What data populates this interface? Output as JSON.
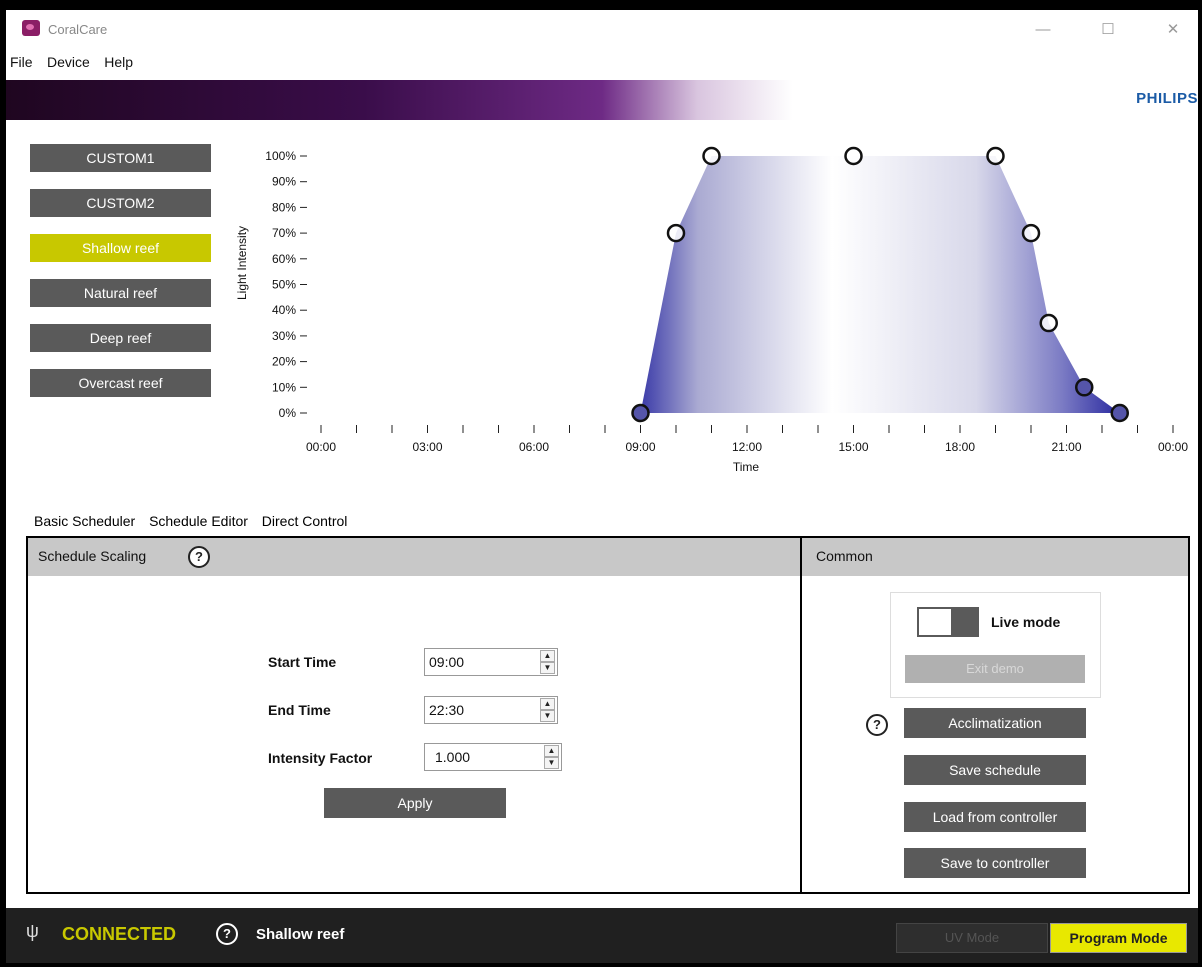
{
  "window": {
    "title": "CoralCare",
    "minimize": "—",
    "maximize": "☐",
    "close": "✕"
  },
  "menu": [
    "File",
    "Device",
    "Help"
  ],
  "brand": "PHILIPS",
  "presets": [
    {
      "label": "CUSTOM1",
      "active": false
    },
    {
      "label": "CUSTOM2",
      "active": false
    },
    {
      "label": "Shallow reef",
      "active": true
    },
    {
      "label": "Natural reef",
      "active": false
    },
    {
      "label": "Deep reef",
      "active": false
    },
    {
      "label": "Overcast reef",
      "active": false
    }
  ],
  "chart_data": {
    "type": "area",
    "xlabel": "Time",
    "ylabel": "Light Intensity",
    "x_ticks": [
      "00:00",
      "03:00",
      "06:00",
      "09:00",
      "12:00",
      "15:00",
      "18:00",
      "21:00",
      "00:00"
    ],
    "y_ticks": [
      "0%",
      "10%",
      "20%",
      "30%",
      "40%",
      "50%",
      "60%",
      "70%",
      "80%",
      "90%",
      "100%"
    ],
    "ylim": [
      0,
      100
    ],
    "xlim_hours": [
      0,
      24
    ],
    "points": [
      {
        "x": "09:00",
        "y": 0,
        "style": "filled"
      },
      {
        "x": "10:00",
        "y": 70,
        "style": "hollow"
      },
      {
        "x": "11:00",
        "y": 100,
        "style": "hollow"
      },
      {
        "x": "15:00",
        "y": 100,
        "style": "hollow"
      },
      {
        "x": "19:00",
        "y": 100,
        "style": "hollow"
      },
      {
        "x": "20:00",
        "y": 70,
        "style": "hollow"
      },
      {
        "x": "20:30",
        "y": 35,
        "style": "hollow"
      },
      {
        "x": "21:30",
        "y": 10,
        "style": "filled"
      },
      {
        "x": "22:30",
        "y": 0,
        "style": "filled"
      }
    ],
    "colors": {
      "fill_edge": "#3a3aa8",
      "fill_mid": "#ffffff",
      "filled_marker": "#5555aa",
      "hollow_marker": "#aaaaaa"
    }
  },
  "tabs": [
    {
      "label": "Basic Scheduler",
      "active": true
    },
    {
      "label": "Schedule Editor",
      "active": false
    },
    {
      "label": "Direct Control",
      "active": false
    }
  ],
  "scaling": {
    "title": "Schedule Scaling",
    "help": "?",
    "start_label": "Start Time",
    "start_value": "09:00",
    "end_label": "End Time",
    "end_value": "22:30",
    "factor_label": "Intensity Factor",
    "factor_value": "1.000",
    "apply": "Apply",
    "spin_up": "▲",
    "spin_down": "▼"
  },
  "common": {
    "title": "Common",
    "live_mode": "Live mode",
    "exit_demo": "Exit demo",
    "help": "?",
    "acclimatization": "Acclimatization",
    "save_schedule": "Save schedule",
    "load_controller": "Load from controller",
    "save_controller": "Save to controller"
  },
  "status": {
    "usb": "ψ",
    "connected": "CONNECTED",
    "help": "?",
    "preset": "Shallow reef",
    "uv_mode": "UV Mode",
    "program_mode": "Program Mode"
  },
  "colors": {
    "accent_yellow": "#c8c800",
    "button_gray": "#5a5a5a",
    "brand_blue": "#1b5ba6"
  }
}
